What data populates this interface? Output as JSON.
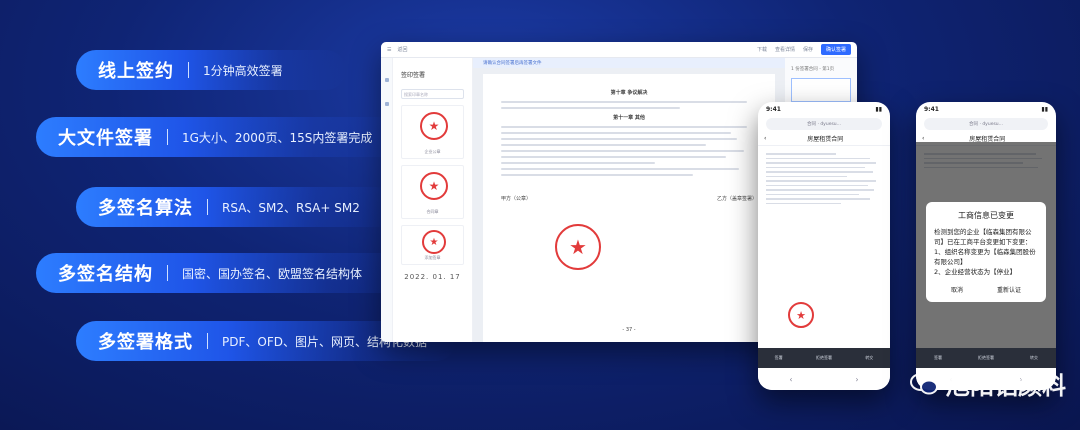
{
  "features": [
    {
      "title": "线上签约",
      "subtitle": "1分钟高效签署"
    },
    {
      "title": "大文件签署",
      "subtitle": "1G大小、2000页、15S内签署完成"
    },
    {
      "title": "多签名算法",
      "subtitle": "RSA、SM2、RSA+ SM2"
    },
    {
      "title": "多签名结构",
      "subtitle": "国密、国办签名、欧盟签名结构体"
    },
    {
      "title": "多签署格式",
      "subtitle": "PDF、OFD、图片、网页、结构化数据"
    }
  ],
  "desktop": {
    "back_label": "返回",
    "toolbar": {
      "download": "下载",
      "view": "查看详情",
      "save": "保存",
      "send": "确认签署"
    },
    "panel_title": "签印签署",
    "search_placeholder": "搜索印章名称",
    "seal_labels": [
      "企业公章",
      "合同章",
      "法人章"
    ],
    "add_seal": "添加签章",
    "date_stamp": "2022. 01. 17",
    "tip": "请确认合同签署后再签署文件",
    "chapter10": "第十章  争议解决",
    "chapter11": "第十一章  其他",
    "party_a": "甲方（公章）",
    "party_b": "乙方（盖章签署）",
    "page_no": "- 37 -",
    "right_note": "1 份签署合同 - 第1页"
  },
  "phone1": {
    "time": "9:41",
    "url": "合同 · dyuesu...",
    "title": "房屋租赁合同",
    "tabs": [
      "签署",
      "拒绝签署",
      "转交"
    ]
  },
  "phone2": {
    "time": "9:41",
    "url": "合同 · dyuesu...",
    "title": "房屋租赁合同",
    "modal_title": "工商信息已变更",
    "modal_lines": [
      "检测到您的企业【临森集团有限公司】已在工商平台变更如下变更：",
      "1、组织名称变更为【临森集团股份有限公司】",
      "2、企业经营状态为【停业】"
    ],
    "cancel": "取消",
    "confirm": "重新认证",
    "tabs": [
      "签署",
      "拒绝签署",
      "转交"
    ]
  },
  "watermark": "旭阳铝颜料"
}
